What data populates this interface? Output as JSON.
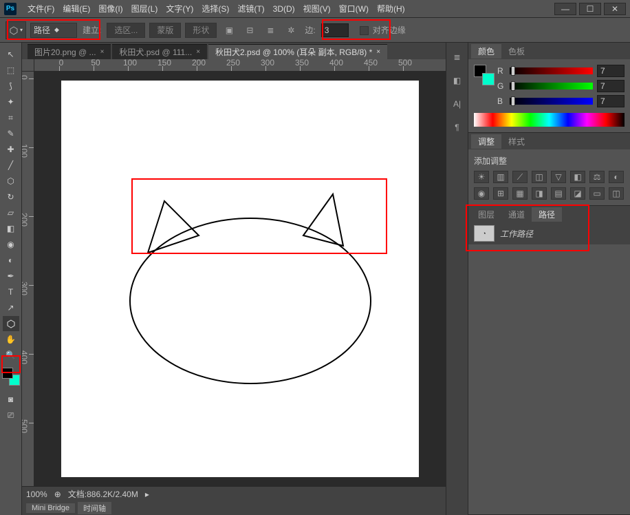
{
  "app": {
    "logo": "Ps"
  },
  "menu": {
    "file": "文件(F)",
    "edit": "编辑(E)",
    "image": "图像(I)",
    "layer": "图层(L)",
    "type": "文字(Y)",
    "select": "选择(S)",
    "filter": "滤镜(T)",
    "threed": "3D(D)",
    "view": "视图(V)",
    "window": "窗口(W)",
    "help": "帮助(H)"
  },
  "optbar": {
    "mode": "路径",
    "build_label": "建立:",
    "btn_selection": "选区...",
    "btn_mask": "蒙版",
    "btn_shape": "形状",
    "edge_label": "边:",
    "edge_value": "3",
    "align_label": "对齐边缘"
  },
  "tabs": {
    "t1": "图片20.png @ ...",
    "t2": "秋田犬.psd @ 111...",
    "t3": "秋田犬2.psd @ 100% (耳朵 副本, RGB/8) *"
  },
  "ruler": {
    "h0": "0",
    "h50": "50",
    "h100": "100",
    "h150": "150",
    "h200": "200",
    "h250": "250",
    "h300": "300",
    "h350": "350",
    "h400": "400",
    "h450": "450",
    "h500": "500",
    "v0": "0",
    "v100": "100",
    "v200": "200",
    "v300": "300",
    "v400": "400",
    "v500": "500"
  },
  "status": {
    "zoom": "100%",
    "docinfo": "文档:886.2K/2.40M"
  },
  "bottom_tabs": {
    "minibridge": "Mini Bridge",
    "timeline": "时间轴"
  },
  "panels": {
    "color_tab": "颜色",
    "swatch_tab": "色板",
    "r_label": "R",
    "g_label": "G",
    "b_label": "B",
    "r_val": "7",
    "g_val": "7",
    "b_val": "7",
    "adjust_tab": "调整",
    "style_tab": "样式",
    "adjust_title": "添加调整",
    "layers_tab": "图层",
    "channels_tab": "通道",
    "paths_tab": "路径",
    "work_path": "工作路径"
  }
}
